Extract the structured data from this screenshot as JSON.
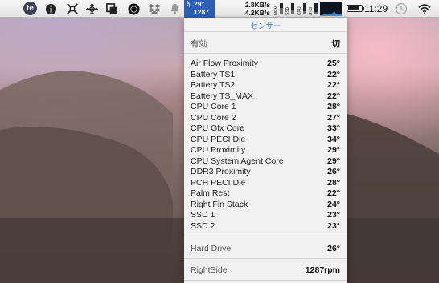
{
  "menubar": {
    "te_label": "te",
    "temp_label": "ZP",
    "temp_value": "29°",
    "fan_value": "1287",
    "net_up": "2.8KB/s",
    "net_down": "4.2KB/s",
    "gauges": [
      {
        "label": "MEM",
        "fill": 0.6
      },
      {
        "label": "SSD",
        "fill": 0.45
      },
      {
        "label": "CPU",
        "fill": 0.3
      },
      {
        "label": "SYS",
        "fill": 0.25
      }
    ],
    "battery_level": 0.9,
    "clock": "11:29"
  },
  "panel": {
    "title": "センサー",
    "enabled": {
      "label": "有効",
      "value": "切"
    },
    "sensors": [
      {
        "name": "Air Flow Proximity",
        "value": "25°"
      },
      {
        "name": "Battery TS1",
        "value": "22°"
      },
      {
        "name": "Battery TS2",
        "value": "22°"
      },
      {
        "name": "Battery TS_MAX",
        "value": "22°"
      },
      {
        "name": "CPU Core 1",
        "value": "28°"
      },
      {
        "name": "CPU Core 2",
        "value": "27°"
      },
      {
        "name": "CPU Gfx Core",
        "value": "33°"
      },
      {
        "name": "CPU PECI Die",
        "value": "34°"
      },
      {
        "name": "CPU Proximity",
        "value": "29°"
      },
      {
        "name": "CPU System Agent Core",
        "value": "29°"
      },
      {
        "name": "DDR3 Proximity",
        "value": "26°"
      },
      {
        "name": "PCH PECI Die",
        "value": "28°"
      },
      {
        "name": "Palm Rest",
        "value": "22°"
      },
      {
        "name": "Right Fin Stack",
        "value": "24°"
      },
      {
        "name": "SSD 1",
        "value": "23°"
      },
      {
        "name": "SSD 2",
        "value": "23°"
      }
    ],
    "drive": {
      "name": "Hard Drive",
      "value": "26°"
    },
    "fan": {
      "name": "RightSide",
      "value": "1287rpm"
    }
  }
}
